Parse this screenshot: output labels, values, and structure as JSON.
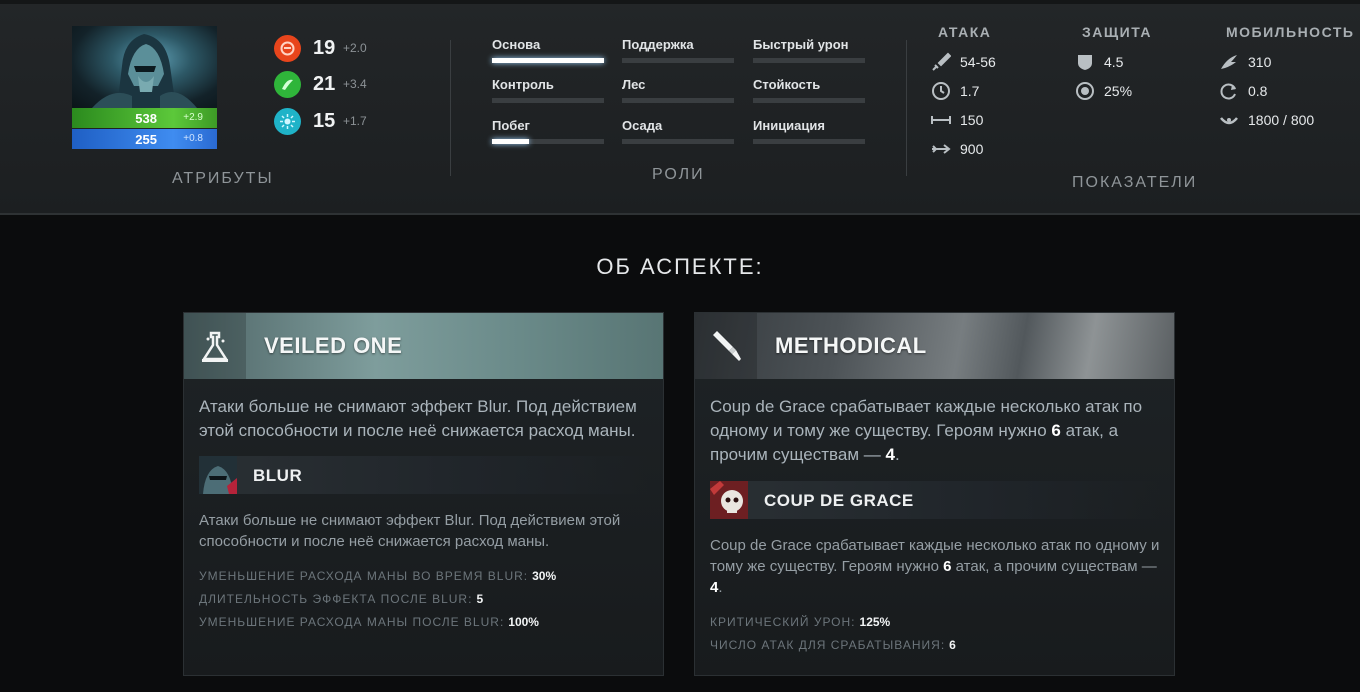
{
  "hero": {
    "health": "538",
    "health_regen": "+2.9",
    "mana": "255",
    "mana_regen": "+0.8"
  },
  "attributes": {
    "label": "АТРИБУТЫ",
    "items": [
      {
        "icon": "strength-icon",
        "value": "19",
        "gain": "+2.0",
        "color": "#e8451c"
      },
      {
        "icon": "agility-icon",
        "value": "21",
        "gain": "+3.4",
        "color": "#2fb53a"
      },
      {
        "icon": "intelligence-icon",
        "value": "15",
        "gain": "+1.7",
        "color": "#1fb3c8"
      }
    ]
  },
  "roles": {
    "label": "РОЛИ",
    "items": [
      {
        "name": "Основа",
        "level": 1.0
      },
      {
        "name": "Поддержка",
        "level": 0
      },
      {
        "name": "Быстрый урон",
        "level": 0
      },
      {
        "name": "Контроль",
        "level": 0
      },
      {
        "name": "Лес",
        "level": 0
      },
      {
        "name": "Стойкость",
        "level": 0
      },
      {
        "name": "Побег",
        "level": 0.33
      },
      {
        "name": "Осада",
        "level": 0
      },
      {
        "name": "Инициация",
        "level": 0
      }
    ]
  },
  "stats": {
    "label": "ПОКАЗАТЕЛИ",
    "attack": {
      "title": "АТАКА",
      "damage": "54-56",
      "attack_time": "1.7",
      "attack_range": "150",
      "projectile_speed": "900"
    },
    "defense": {
      "title": "ЗАЩИТА",
      "armor": "4.5",
      "magic_resist": "25%"
    },
    "mobility": {
      "title": "МОБИЛЬНОСТЬ",
      "move_speed": "310",
      "turn_rate": "0.8",
      "vision": "1800 / 800"
    }
  },
  "facets": {
    "heading": "ОБ АСПЕКТЕ:",
    "left": {
      "title": "VEILED ONE",
      "icon": "flask-icon",
      "desc": "Атаки больше не снимают эффект Blur. Под действием этой способности и после неё снижается расход маны.",
      "ability_name": "BLUR",
      "ability_desc": "Атаки больше не снимают эффект Blur. Под действием этой способности и после неё снижается расход маны.",
      "props": [
        {
          "label": "УМЕНЬШЕНИЕ РАСХОДА МАНЫ ВО ВРЕМЯ BLUR:",
          "value": "30%"
        },
        {
          "label": "ДЛИТЕЛЬНОСТЬ ЭФФЕКТА ПОСЛЕ BLUR:",
          "value": "5"
        },
        {
          "label": "УМЕНЬШЕНИЕ РАСХОДА МАНЫ ПОСЛЕ BLUR:",
          "value": "100%"
        }
      ]
    },
    "right": {
      "title": "METHODICAL",
      "icon": "dagger-icon",
      "desc_part1": "Coup de Grace срабатывает каждые несколько атак по одному и тому же существу. Героям нужно ",
      "desc_hero": "6",
      "desc_part2": " атак, а прочим существам — ",
      "desc_other": "4",
      "desc_part3": ".",
      "ability_name": "COUP DE GRACE",
      "ability_desc_part1": "Coup de Grace срабатывает каждые несколько атак по одному и тому же существу. Героям нужно ",
      "ability_desc_hero": "6",
      "ability_desc_part2": " атак, а прочим существам — ",
      "ability_desc_other": "4",
      "ability_desc_part3": ".",
      "props": [
        {
          "label": "КРИТИЧЕСКИЙ УРОН:",
          "value": "125%"
        },
        {
          "label": "ЧИСЛО АТАК ДЛЯ СРАБАТЫВАНИЯ:",
          "value": "6"
        }
      ]
    }
  }
}
